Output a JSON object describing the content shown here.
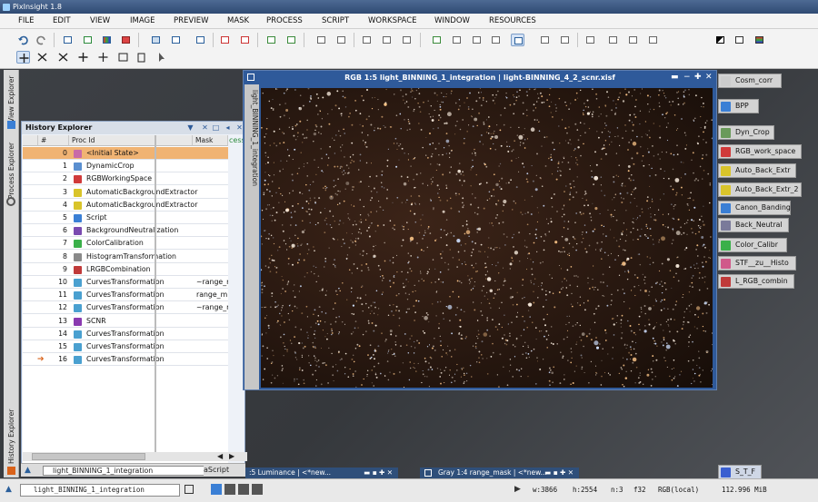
{
  "app": {
    "title": "PixInsight 1.8"
  },
  "menu": [
    "FILE",
    "EDIT",
    "VIEW",
    "IMAGE",
    "PREVIEW",
    "MASK",
    "PROCESS",
    "SCRIPT",
    "WORKSPACE",
    "WINDOW",
    "RESOURCES"
  ],
  "left_tabs": {
    "view_explorer": "View Explorer",
    "process_explorer": "Process Explorer",
    "history_explorer": "History Explorer"
  },
  "history": {
    "title": "History Explorer",
    "columns": {
      "num": "#",
      "proc": "Proc Id",
      "mask": "Mask"
    },
    "rows": [
      {
        "n": "0",
        "proc": "<Initial State>",
        "mask": "",
        "color": "#c86aa8"
      },
      {
        "n": "1",
        "proc": "DynamicCrop",
        "mask": "",
        "color": "#5a8fd0"
      },
      {
        "n": "2",
        "proc": "RGBWorkingSpace",
        "mask": "",
        "color": "#d03a3a"
      },
      {
        "n": "3",
        "proc": "AutomaticBackgroundExtractor",
        "mask": "",
        "color": "#d9c42a"
      },
      {
        "n": "4",
        "proc": "AutomaticBackgroundExtractor",
        "mask": "",
        "color": "#d9c42a"
      },
      {
        "n": "5",
        "proc": "Script",
        "mask": "",
        "color": "#3a7fd5"
      },
      {
        "n": "6",
        "proc": "BackgroundNeutralization",
        "mask": "",
        "color": "#7a4ab0"
      },
      {
        "n": "7",
        "proc": "ColorCalibration",
        "mask": "",
        "color": "#3ab04a"
      },
      {
        "n": "8",
        "proc": "HistogramTransformation",
        "mask": "",
        "color": "#8a8a8a"
      },
      {
        "n": "9",
        "proc": "LRGBCombination",
        "mask": "",
        "color": "#c03a3a"
      },
      {
        "n": "10",
        "proc": "CurvesTransformation",
        "mask": "~range_m",
        "color": "#4aa0d0"
      },
      {
        "n": "11",
        "proc": "CurvesTransformation",
        "mask": "range_m",
        "color": "#4aa0d0"
      },
      {
        "n": "12",
        "proc": "CurvesTransformation",
        "mask": "~range_m",
        "color": "#4aa0d0"
      },
      {
        "n": "13",
        "proc": "SCNR",
        "mask": "",
        "color": "#8a3ab0"
      },
      {
        "n": "14",
        "proc": "CurvesTransformation",
        "mask": "",
        "color": "#4aa0d0"
      },
      {
        "n": "15",
        "proc": "CurvesTransformation",
        "mask": "",
        "color": "#4aa0d0"
      },
      {
        "n": "16",
        "proc": "CurvesTransformation",
        "mask": "",
        "color": "#4aa0d0"
      }
    ],
    "overflow_text": "cess",
    "view_selector": "light_BINNING_1_integration",
    "side_text": "aScript"
  },
  "image_window": {
    "title": "RGB 1:5 light_BINNING_1_integration | light-BINNING_4_2_scnr.xisf",
    "side_label": "light_BINNING_1_integration"
  },
  "process_icons": [
    {
      "label": "Cosm_corr",
      "color": "#cccccc"
    },
    {
      "label": "BPP",
      "color": "#3a7fd5"
    },
    {
      "label": "Dyn_Crop",
      "color": "#6a9a5a"
    },
    {
      "label": "RGB_work_space",
      "color": "#d03a3a"
    },
    {
      "label": "Auto_Back_Extr",
      "color": "#d9c42a"
    },
    {
      "label": "Auto_Back_Extr_2",
      "color": "#d9c42a"
    },
    {
      "label": "Canon_Banding",
      "color": "#3a7fd5"
    },
    {
      "label": "Back_Neutral",
      "color": "#7a7a9a"
    },
    {
      "label": "Color_Calibr",
      "color": "#3ab04a"
    },
    {
      "label": "STF__zu__Histo",
      "color": "#d05a8a"
    },
    {
      "label": "L_RGB_combin",
      "color": "#c03a3a"
    }
  ],
  "bottom_windows": [
    {
      "label": ":5 Luminance | <*new..."
    },
    {
      "label": "Gray 1:4 range_mask | <*new..."
    }
  ],
  "stf_icon": {
    "label": "S_T_F"
  },
  "status": {
    "view": "light_BINNING_1_integration",
    "width": "w:3866",
    "height": "h:2554",
    "channels": "n:3",
    "format": "f32",
    "color_space": "RGB(local)",
    "memory": "112.996 MiB"
  }
}
